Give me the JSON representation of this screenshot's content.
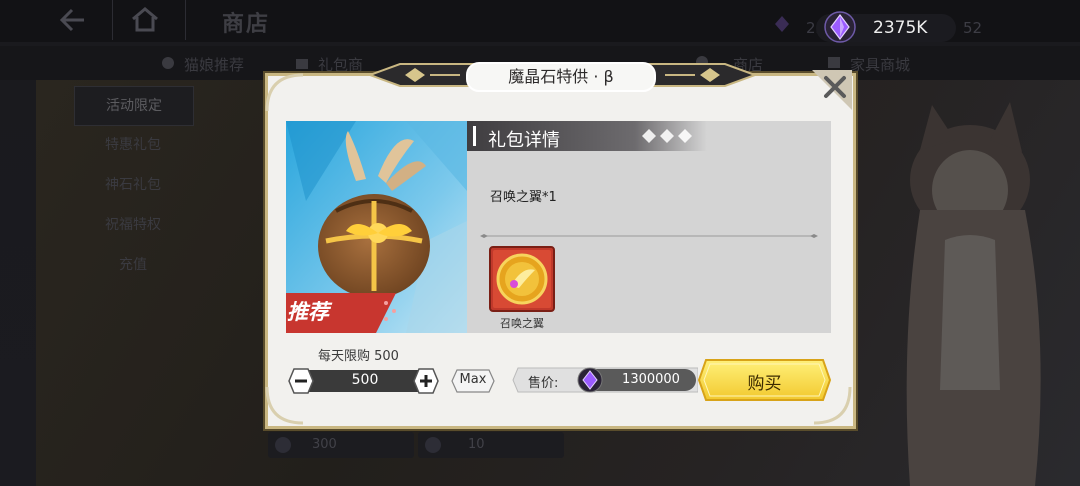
{
  "header": {
    "title": "商店",
    "currency_small": "23",
    "currency_main": "2375K",
    "currency_other": "52"
  },
  "subnav": {
    "tabs": [
      {
        "label": "猫娘推荐"
      },
      {
        "label": "礼包商"
      },
      {
        "label": "…商店"
      },
      {
        "label": "家具商城"
      }
    ]
  },
  "sidebar": {
    "items": [
      {
        "label": "活动限定"
      },
      {
        "label": "特惠礼包"
      },
      {
        "label": "神石礼包"
      },
      {
        "label": "祝福特权"
      },
      {
        "label": "充值"
      }
    ]
  },
  "background_cards": [
    {
      "value": "300"
    },
    {
      "value": "10"
    }
  ],
  "modal": {
    "title": "魔晶石特供 · β",
    "promo_tag": "推荐",
    "detail_title": "礼包详情",
    "contents": "召唤之翼*1",
    "item_name": "召唤之翼",
    "daily_limit": "每天限购  500",
    "quantity": "500",
    "max_label": "Max",
    "price_label": "售价:",
    "price_value": "1300000",
    "buy_label": "购买"
  },
  "colors": {
    "accent_gold": "#f5d54a",
    "frame_gold": "#c9b782",
    "gem_purple": "#9b5cff",
    "panel_gray": "#d4d4d4"
  },
  "icons": [
    "back-icon",
    "home-icon",
    "gem-icon",
    "close-icon",
    "minus-icon",
    "plus-icon",
    "gift-bag-icon",
    "summon-wing-coin-icon"
  ]
}
